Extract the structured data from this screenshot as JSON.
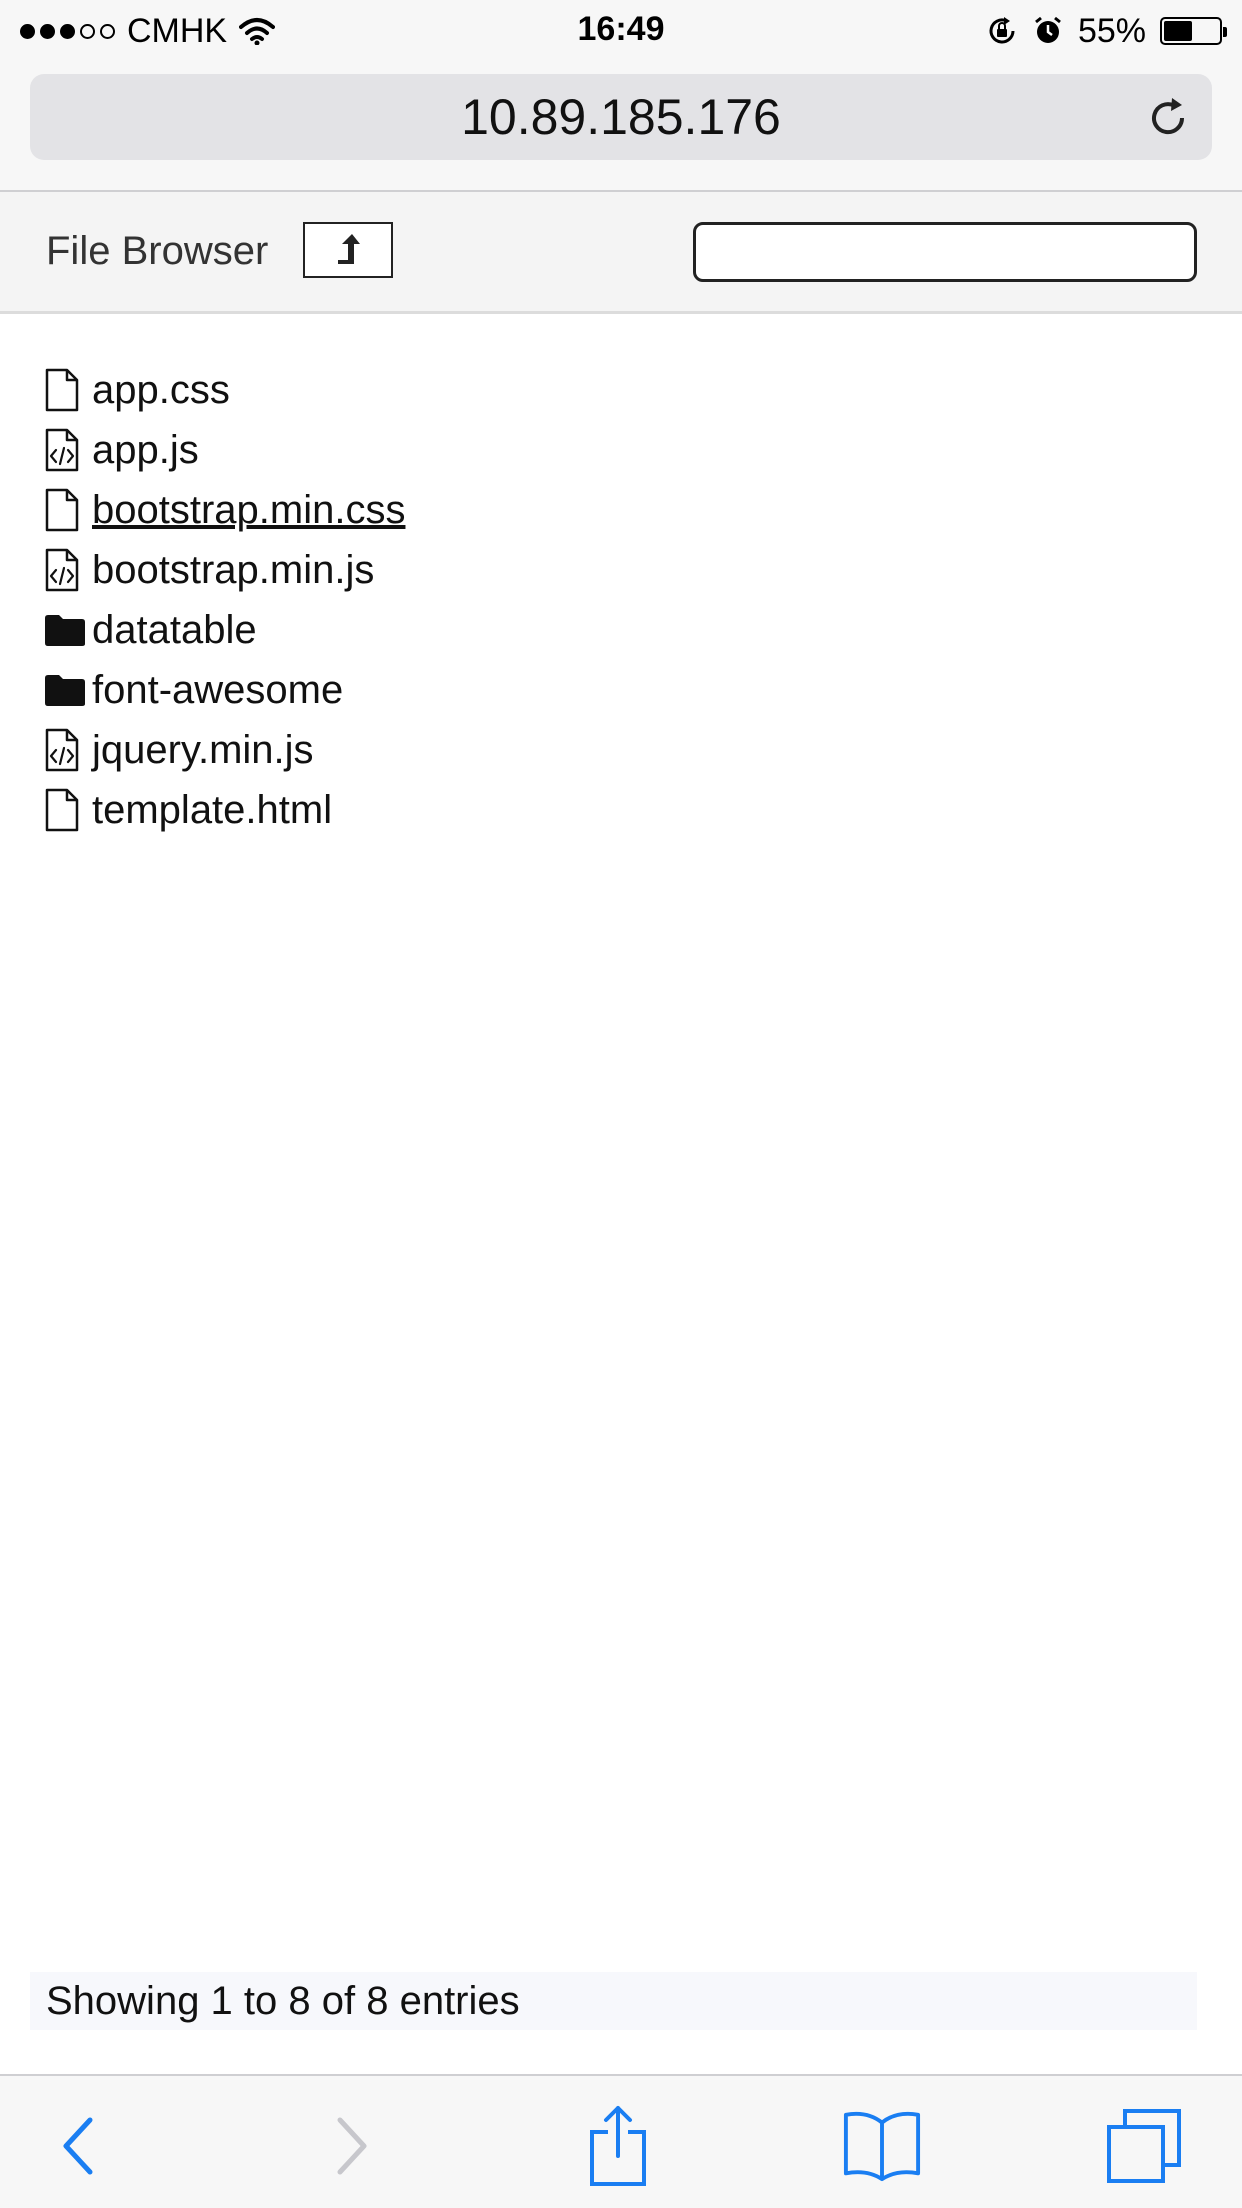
{
  "status_bar": {
    "carrier": "CMHK",
    "time": "16:49",
    "battery_percent": "55%",
    "battery_level": 0.55,
    "signal_bars_filled": 3,
    "signal_bars_total": 5,
    "icons": [
      "wifi-icon",
      "orientation-lock-icon",
      "alarm-icon",
      "battery-icon"
    ]
  },
  "address_bar": {
    "url": "10.89.185.176",
    "reload_icon": "reload-icon"
  },
  "header": {
    "title": "File Browser",
    "up_icon": "upload-arrow-icon",
    "search_value": "",
    "search_placeholder": ""
  },
  "files": [
    {
      "name": "app.css",
      "icon": "file-icon",
      "type": "file",
      "underlined": false
    },
    {
      "name": "app.js",
      "icon": "code-file-icon",
      "type": "file",
      "underlined": false
    },
    {
      "name": "bootstrap.min.css",
      "icon": "file-icon",
      "type": "file",
      "underlined": true
    },
    {
      "name": "bootstrap.min.js",
      "icon": "code-file-icon",
      "type": "file",
      "underlined": false
    },
    {
      "name": "datatable",
      "icon": "folder-icon",
      "type": "folder",
      "underlined": false
    },
    {
      "name": "font-awesome",
      "icon": "folder-icon",
      "type": "folder",
      "underlined": false
    },
    {
      "name": "jquery.min.js",
      "icon": "code-file-icon",
      "type": "file",
      "underlined": false
    },
    {
      "name": "template.html",
      "icon": "file-icon",
      "type": "file",
      "underlined": false
    }
  ],
  "footer": {
    "info_text": "Showing 1 to 8 of 8 entries"
  },
  "toolbar": {
    "icons": [
      "back-icon",
      "forward-icon",
      "share-icon",
      "bookmarks-icon",
      "tabs-icon"
    ],
    "accent_color": "#1a7ef2",
    "disabled_color": "#c7c7cc"
  }
}
